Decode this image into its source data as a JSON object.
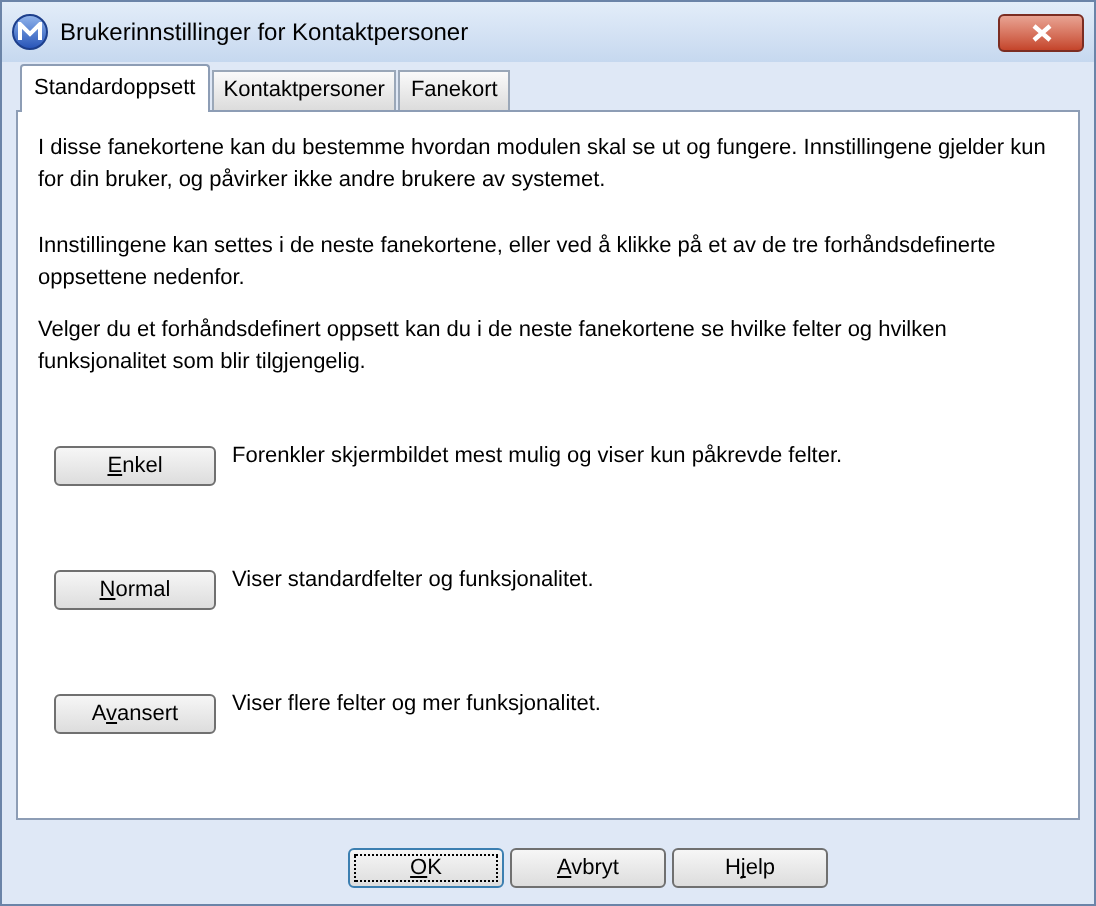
{
  "window": {
    "title": "Brukerinnstillinger for Kontaktpersoner"
  },
  "tabs": [
    {
      "label": "Standardoppsett",
      "selected": true
    },
    {
      "label": "Kontaktpersoner",
      "selected": false
    },
    {
      "label": "Fanekort",
      "selected": false
    }
  ],
  "paragraphs": [
    "I disse fanekortene kan du bestemme hvordan modulen skal se ut og fungere. Innstillingene gjelder kun for din bruker, og påvirker ikke andre brukere av systemet.",
    "Innstillingene kan settes i de neste fanekortene, eller ved å klikke på et av de tre forhåndsdefinerte oppsettene nedenfor.",
    "Velger du et forhåndsdefinert oppsett kan du i de neste fanekortene se hvilke felter og hvilken funksjonalitet som blir tilgjengelig."
  ],
  "presets": [
    {
      "accel": "E",
      "after": "nkel",
      "description": "Forenkler skjermbildet mest mulig og viser kun påkrevde felter."
    },
    {
      "accel": "N",
      "after": "ormal",
      "description": "Viser standardfelter og funksjonalitet."
    },
    {
      "before": "A",
      "accel": "v",
      "after": "ansert",
      "description": "Viser flere felter og mer funksjonalitet."
    }
  ],
  "buttons": [
    {
      "accel": "O",
      "after": "K",
      "focused": true
    },
    {
      "accel": "A",
      "after": "vbryt",
      "focused": false
    },
    {
      "before": "H",
      "accel": "j",
      "after": "elp",
      "focused": false
    }
  ]
}
